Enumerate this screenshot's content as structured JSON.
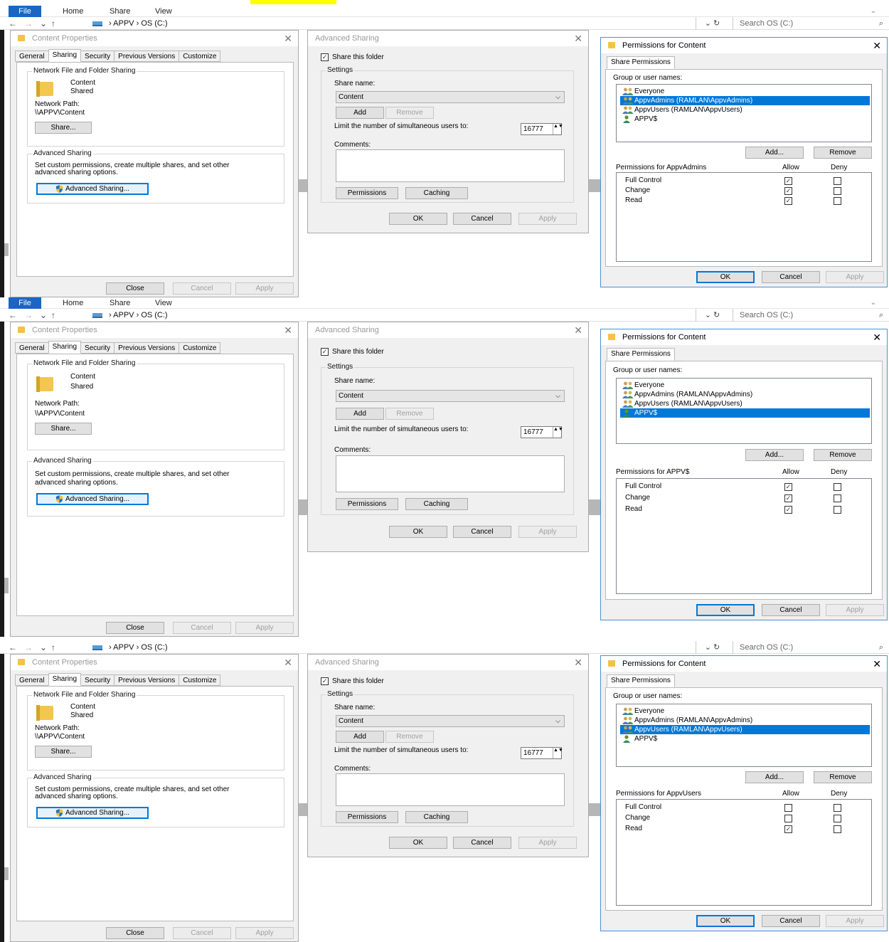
{
  "ribbon": {
    "file": "File",
    "tabs": [
      "Home",
      "Share",
      "View"
    ]
  },
  "address": {
    "path_parts": [
      "APPV",
      "OS (C:)"
    ],
    "search_placeholder": "Search OS (C:)"
  },
  "colors": {
    "highlight": "#ffff00",
    "selection": "#0078d7",
    "file_tab": "#1a66c2"
  },
  "icons": {
    "back": "arrow-left-icon",
    "forward": "arrow-right-icon",
    "recent": "chevron-down-icon",
    "up": "arrow-up-icon",
    "refresh": "refresh-icon",
    "search": "search-icon"
  },
  "props": {
    "title": "Content Properties",
    "tabs": [
      "General",
      "Sharing",
      "Security",
      "Previous Versions",
      "Customize"
    ],
    "active_tab": "Sharing",
    "network_group": "Network File and Folder Sharing",
    "folder_name": "Content",
    "folder_state": "Shared",
    "network_path_label": "Network Path:",
    "network_path": "\\\\APPV\\Content",
    "share_button": "Share...",
    "adv_group": "Advanced Sharing",
    "adv_desc_1": "Set custom permissions, create multiple shares, and set other",
    "adv_desc_2": "advanced sharing options.",
    "adv_button": "Advanced Sharing...",
    "close": "Close",
    "cancel": "Cancel",
    "apply": "Apply"
  },
  "adv": {
    "title": "Advanced Sharing",
    "share_checkbox": "Share this folder",
    "settings": "Settings",
    "share_name_label": "Share name:",
    "share_name": "Content",
    "add": "Add",
    "remove": "Remove",
    "limit_label": "Limit the number of simultaneous users to:",
    "limit_value": "16777",
    "comments_label": "Comments:",
    "permissions": "Permissions",
    "caching": "Caching",
    "ok": "OK",
    "cancel": "Cancel",
    "apply": "Apply"
  },
  "perm": {
    "title": "Permissions for Content",
    "tab": "Share Permissions",
    "group_label": "Group or user names:",
    "users": [
      "Everyone",
      "AppvAdmins (RAMLAN\\AppvAdmins)",
      "AppvUsers (RAMLAN\\AppvUsers)",
      "APPV$"
    ],
    "add": "Add...",
    "remove": "Remove",
    "allow": "Allow",
    "deny": "Deny",
    "perm_names": [
      "Full Control",
      "Change",
      "Read"
    ],
    "ok": "OK",
    "cancel": "Cancel",
    "apply": "Apply"
  },
  "sections": [
    {
      "selected_user": 1,
      "permissions_for": "Permissions for AppvAdmins",
      "allow": [
        true,
        true,
        true
      ],
      "deny": [
        false,
        false,
        false
      ]
    },
    {
      "selected_user": 3,
      "permissions_for": "Permissions for APPV$",
      "allow": [
        true,
        true,
        true
      ],
      "deny": [
        false,
        false,
        false
      ]
    },
    {
      "selected_user": 2,
      "permissions_for": "Permissions for AppvUsers",
      "allow": [
        false,
        false,
        true
      ],
      "deny": [
        false,
        false,
        false
      ]
    }
  ]
}
